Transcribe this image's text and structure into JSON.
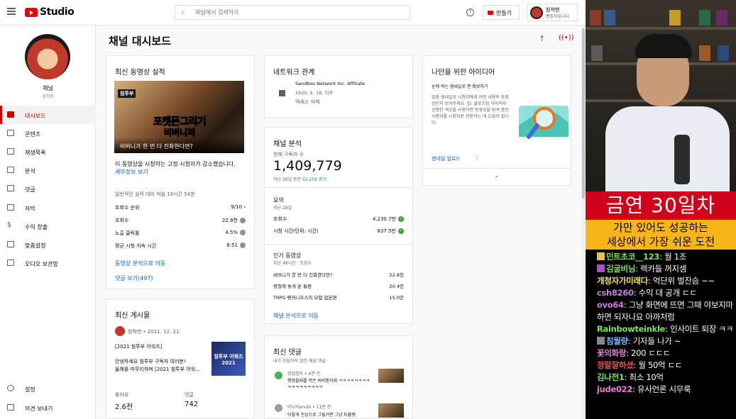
{
  "topbar": {
    "app_name": "Studio",
    "search_placeholder": "채널에서 검색하기",
    "create_label": "만들기",
    "account_name": "침착맨",
    "account_role": "편집자입니다"
  },
  "sidebar": {
    "channel_label": "채널",
    "channel_name": "침착맨",
    "items": [
      {
        "label": "대시보드",
        "icon": "dashboard-icon",
        "active": true
      },
      {
        "label": "콘텐츠",
        "icon": "content-icon"
      },
      {
        "label": "재생목록",
        "icon": "playlist-icon"
      },
      {
        "label": "분석",
        "icon": "analytics-icon"
      },
      {
        "label": "댓글",
        "icon": "comments-icon"
      },
      {
        "label": "자막",
        "icon": "subtitles-icon"
      },
      {
        "label": "수익 창출",
        "icon": "dollar-icon"
      },
      {
        "label": "맞춤설정",
        "icon": "wand-icon"
      },
      {
        "label": "오디오 보관함",
        "icon": "audio-library-icon"
      }
    ],
    "bottom_items": [
      {
        "label": "설정",
        "icon": "gear-icon"
      },
      {
        "label": "의견 보내기",
        "icon": "feedback-icon"
      }
    ]
  },
  "page_title": "채널 대시보드",
  "latest_video": {
    "title": "최신 동영상 실적",
    "thumb_tag": "침투부",
    "thumb_big1": "포켓몬그리기",
    "thumb_big2": "비버니찌",
    "thumb_caption": "비버니가 한 번 더 진화한다면?",
    "note": "이 동영상을 시청하는 고정 시청자가 감소했습니다.",
    "note_link": "세부정보 보기",
    "compare": "일반적인 실적 대비 처음 18시간 54분",
    "rows": [
      {
        "label": "조회수 순위",
        "value": "9/10 ›"
      },
      {
        "label": "조회수",
        "value": "22.8천"
      },
      {
        "label": "노출 클릭률",
        "value": "4.5%"
      },
      {
        "label": "평균 시청 지속 시간",
        "value": "8:51"
      }
    ],
    "link1": "동영상 분석으로 이동",
    "link2": "댓글 보기(497)"
  },
  "latest_post": {
    "title": "최신 게시물",
    "author_date": "침착맨 • 2021. 12. 21.",
    "line1": "[2021 침투부 어워즈]",
    "line2": "안녕하세요 침투부 구독자 여러분!",
    "line3": "올해를 마무리하며 [2021 침투부 어워...",
    "thumb_text": "침투부 어워즈 2021",
    "likes_label": "좋아요",
    "likes_value": "2.6천",
    "comments_label": "댓글",
    "comments_value": "742"
  },
  "network": {
    "title": "네트워크 관계",
    "name": "Sandbox Network Inc. Affiliate",
    "since": "2020. 5. 18. 이후",
    "action": "액세스 삭제"
  },
  "analytics": {
    "title": "채널 분석",
    "subs_label": "현재 구독자 수",
    "subs_value": "1,409,779",
    "subs_change_prefix": "지난 28일 동안",
    "subs_change": "62,258 증가",
    "summary_title": "요약",
    "summary_period": "지난 28일",
    "summary_rows": [
      {
        "label": "조회수",
        "value": "4,230.7만"
      },
      {
        "label": "시청 시간(단위: 시간)",
        "value": "837.5만"
      }
    ],
    "top_title": "인기 동영상",
    "top_period": "지난 48시간 · 조회수",
    "top_rows": [
      {
        "label": "비버니가 한 번 더 진화한다면?",
        "value": "22.8천"
      },
      {
        "label": "명절에 늦게 온 통편",
        "value": "20.4만"
      },
      {
        "label": "TRPG 펭귀니우스의 모험 합본편",
        "value": "15.0만"
      }
    ],
    "link": "채널 분석으로 이동"
  },
  "latest_comments": {
    "title": "최신 댓글",
    "subtitle": "내가 응답하지 않은 채널 댓글",
    "items": [
      {
        "author": "헝었잖아 • 4분 전",
        "text": "행명블래를 먹은 비버통이래 ㅋㅋㅋㅋㅋㅋㅋㅋㅋㅋㅋㅋㅋㅋㅋㅋㅋ"
      },
      {
        "author": "마누비anubi • 11분 전",
        "text": "이렇게 진심으로 그릴거면 그냥 티뷸렛"
      }
    ]
  },
  "ideas": {
    "title": "나만을 위한 아이디어",
    "heading": "눈에 띄는 썸네일로 편 확보하기",
    "body": "맞춤 썸네일로 시청자에게 어떤 내용의 동영상인지 보여주세요. 팁: 클로즈업 이미지와 선명한 색상을 사용하면 동영상을 탐색 중인 사용자를 시청자로 전환하는 데 도움이 됩니다.",
    "link": "썸네일 업로드"
  },
  "stream": {
    "band_title": "금연 30일차",
    "band_sub1": "가만 있어도 성공하는",
    "band_sub2": "세상에서 가장 쉬운 도전",
    "chat": [
      {
        "name": "민트초코__123",
        "text": "월 1조",
        "color": "#7ee35a",
        "badge": "#e8c04a"
      },
      {
        "name": "김굴비님",
        "text": "렉카들 꺼지셈",
        "color": "#7ee35a",
        "badge": "#b04ad0"
      },
      {
        "name": "개청자가미래다",
        "text": "억단위 벌잔슴 ~~",
        "color": "#f2e84a",
        "badge": ""
      },
      {
        "name": "csh8260",
        "text": "수익 대 공개 ㄷㄷ",
        "color": "#c77ee6",
        "badge": ""
      },
      {
        "name": "ovo64",
        "text": "그냥 화면에 뜨면 그때 야보지마 하면 되자나요 아까처럼",
        "color": "#c77ee6",
        "badge": ""
      },
      {
        "name": "Rainbowteinkle",
        "text": "인사이트 퇴장 ㅋㅋ",
        "color": "#7ee35a",
        "badge": ""
      },
      {
        "name": "침월량",
        "text": "기자들 나가 ~",
        "color": "#7ab6ff",
        "badge": "#888888"
      },
      {
        "name": "꽃의화랑",
        "text": "200 ㄷㄷㄷ",
        "color": "#f07ad8",
        "badge": ""
      },
      {
        "name": "정말잘하셨",
        "text": "월 50억 ㄷㄷ",
        "color": "#ff4a4a",
        "badge": ""
      },
      {
        "name": "김나전1",
        "text": "최소 10억",
        "color": "#7ee35a",
        "badge": ""
      },
      {
        "name": "jude022",
        "text": "유사언론 시무룩",
        "color": "#f07ad8",
        "badge": ""
      }
    ]
  }
}
